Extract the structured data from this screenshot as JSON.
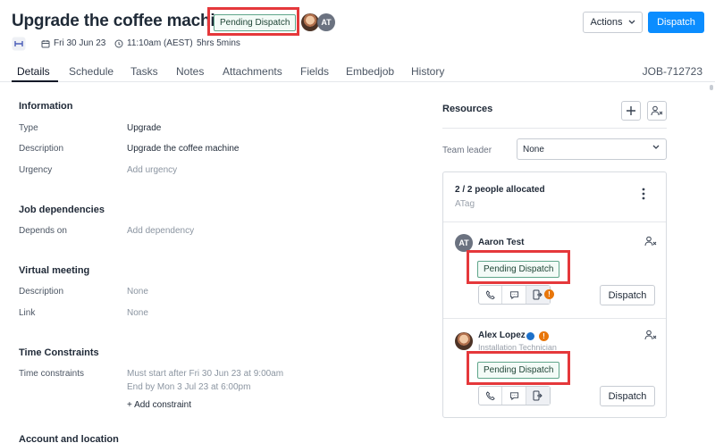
{
  "header": {
    "title": "Upgrade the coffee machine",
    "status": "Pending Dispatch",
    "avatar_initials": "AT",
    "actions_label": "Actions",
    "dispatch_label": "Dispatch"
  },
  "meta": {
    "date": "Fri 30 Jun 23",
    "time": "11:10am (AEST)",
    "duration": "5hrs 5mins"
  },
  "tabs": [
    "Details",
    "Schedule",
    "Tasks",
    "Notes",
    "Attachments",
    "Fields",
    "Embedjob",
    "History"
  ],
  "job_id": "JOB-712723",
  "information": {
    "heading": "Information",
    "type_label": "Type",
    "type_value": "Upgrade",
    "description_label": "Description",
    "description_value": "Upgrade the coffee machine",
    "urgency_label": "Urgency",
    "urgency_value": "Add urgency"
  },
  "dependencies": {
    "heading": "Job dependencies",
    "depends_label": "Depends on",
    "depends_value": "Add dependency"
  },
  "virtual_meeting": {
    "heading": "Virtual meeting",
    "description_label": "Description",
    "description_value": "None",
    "link_label": "Link",
    "link_value": "None"
  },
  "time_constraints": {
    "heading": "Time Constraints",
    "label": "Time constraints",
    "line1": "Must start after Fri 30 Jun 23 at 9:00am",
    "line2": "End by Mon 3 Jul 23 at 6:00pm",
    "add": "+ Add constraint"
  },
  "account": {
    "heading": "Account and location"
  },
  "resources": {
    "title": "Resources",
    "team_leader_label": "Team leader",
    "team_leader_value": "None",
    "allocated": "2 / 2 people allocated",
    "tag": "ATag",
    "people": [
      {
        "initials": "AT",
        "name": "Aaron Test",
        "status": "Pending Dispatch",
        "dispatch_label": "Dispatch"
      },
      {
        "name": "Alex Lopez",
        "role": "Installation Technician",
        "status": "Pending Dispatch",
        "dispatch_label": "Dispatch"
      }
    ]
  },
  "colors": {
    "primary": "#0b8dff",
    "highlight": "#e5383b",
    "warning": "#e8760a",
    "badge_border": "#5fa58a"
  }
}
